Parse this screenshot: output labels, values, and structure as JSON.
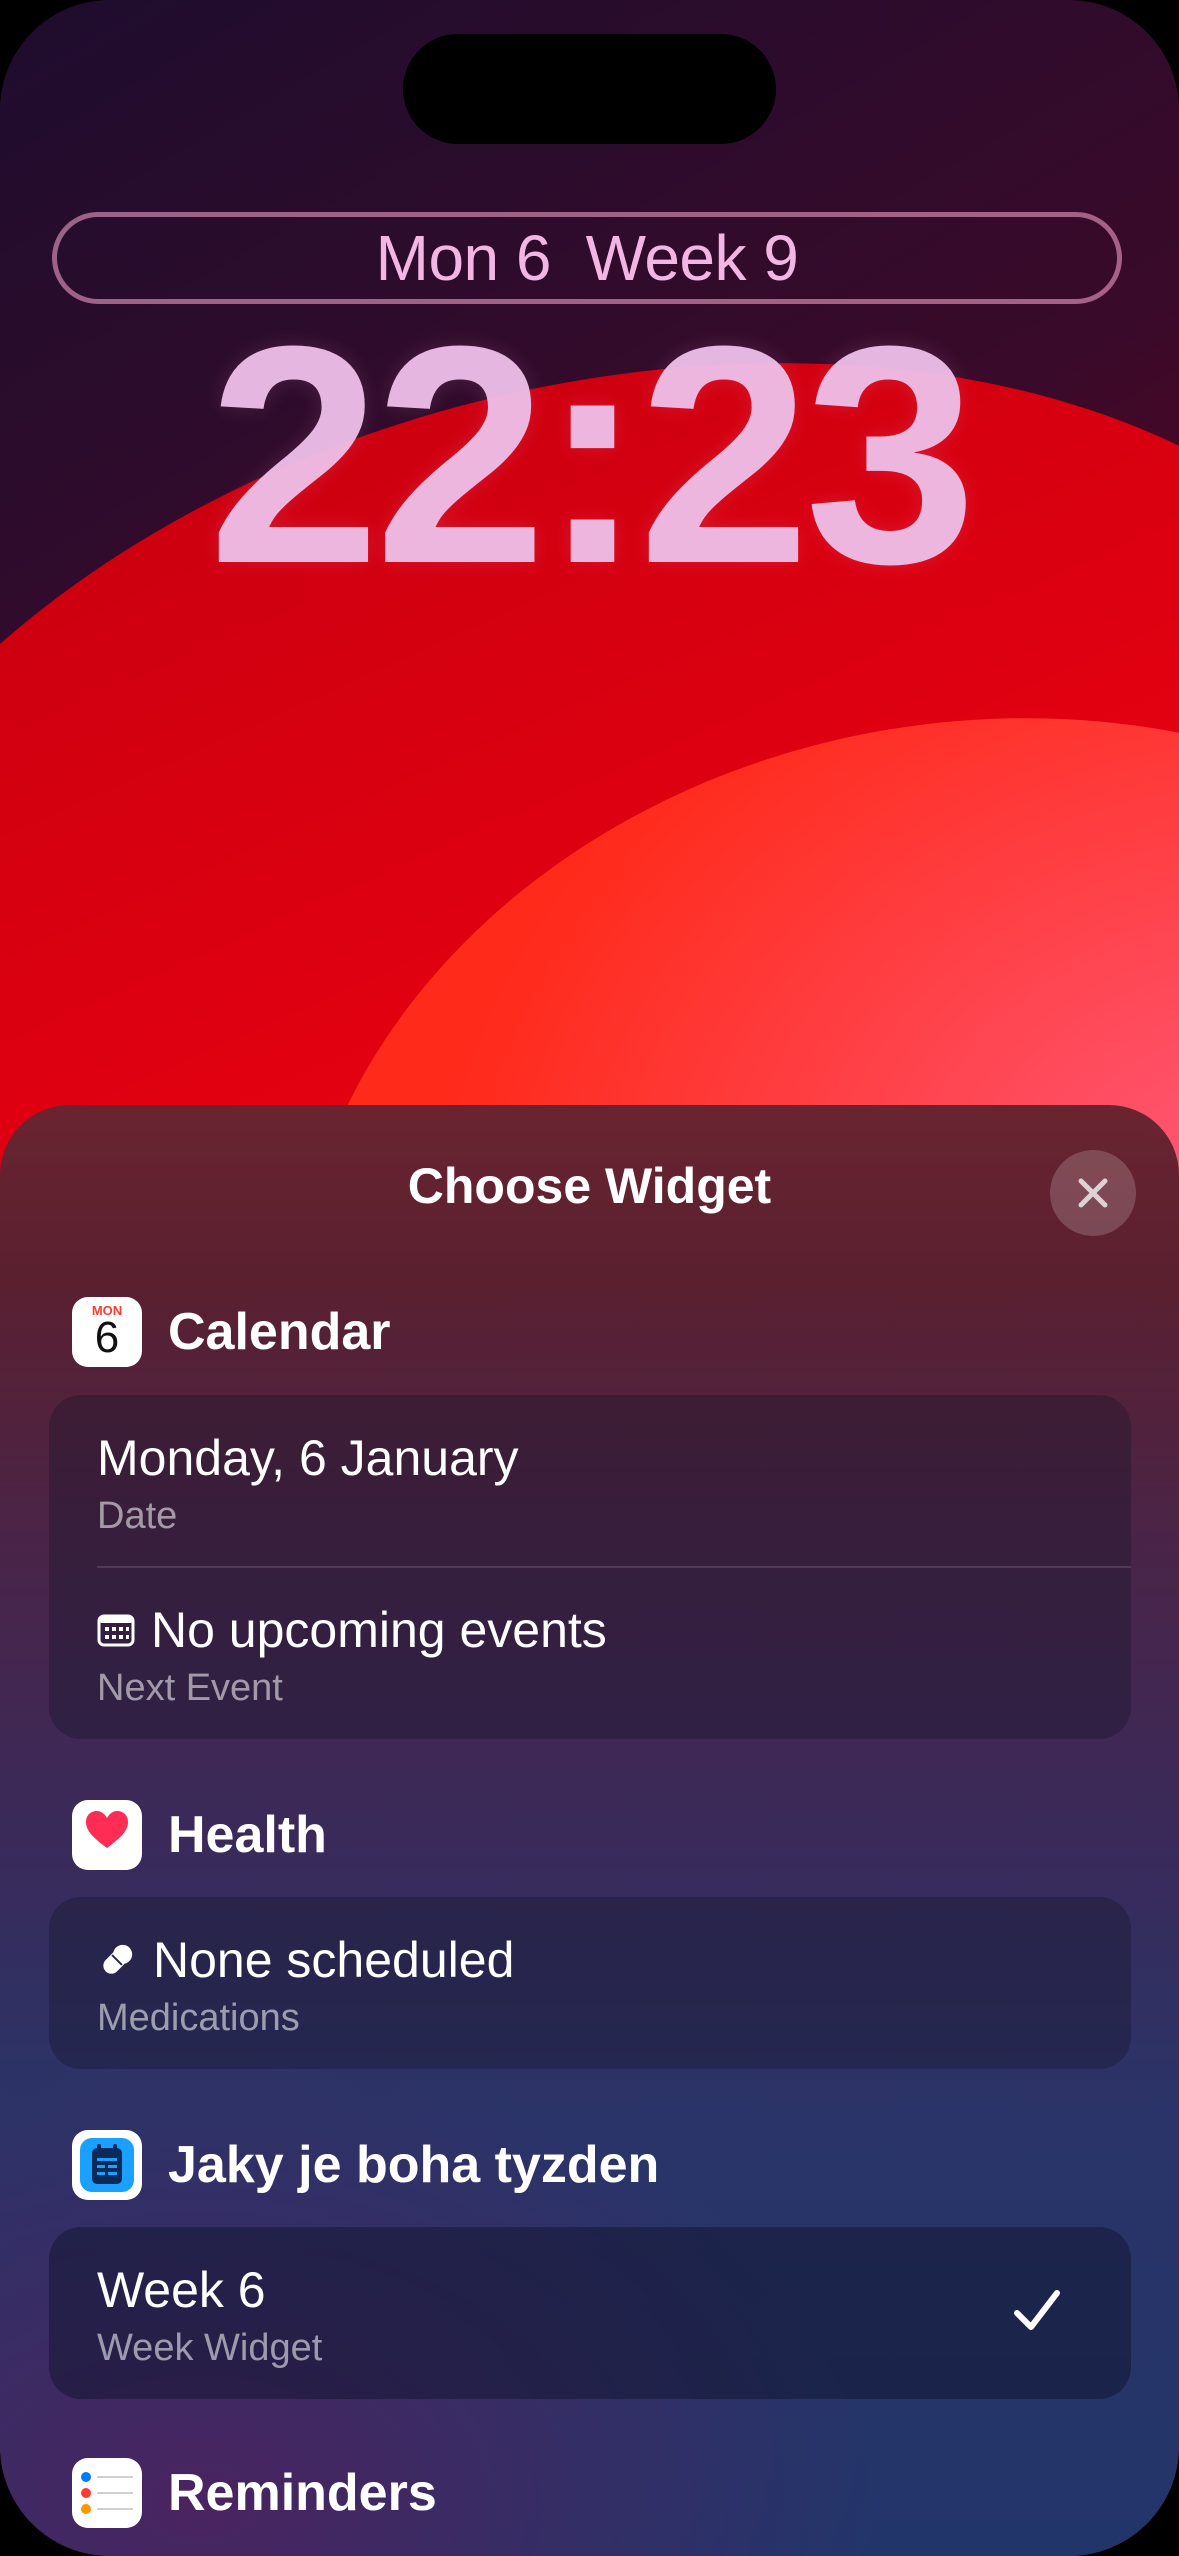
{
  "lock_screen": {
    "date_line": "Mon 6  Week 9",
    "time": "22:23"
  },
  "sheet": {
    "title": "Choose Widget",
    "close_icon": "close-icon"
  },
  "sections": {
    "calendar": {
      "label": "Calendar",
      "icon_day": "MON",
      "icon_date": "6",
      "rows": [
        {
          "title": "Monday, 6 January",
          "subtitle": "Date"
        },
        {
          "title": "No upcoming events",
          "subtitle": "Next Event",
          "icon": "calendar-grid-icon"
        }
      ]
    },
    "health": {
      "label": "Health",
      "icon": "heart-icon",
      "rows": [
        {
          "title": "None scheduled",
          "subtitle": "Medications",
          "icon": "pill-icon"
        }
      ]
    },
    "week_app": {
      "label": "Jaky je boha tyzden",
      "icon": "week-app-icon",
      "rows": [
        {
          "title": "Week 6",
          "subtitle": "Week Widget",
          "selected": true,
          "check_icon": "checkmark-icon"
        }
      ]
    },
    "reminders": {
      "label": "Reminders",
      "icon": "reminders-icon"
    }
  },
  "colors": {
    "calendar_red": "#ff3b30",
    "health_pink": "#ff2d55",
    "week_app_blue": "#1aa0ff"
  }
}
